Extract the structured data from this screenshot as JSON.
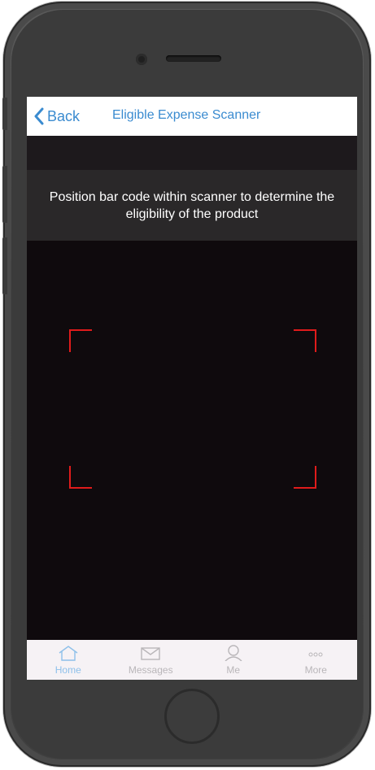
{
  "navbar": {
    "back_label": "Back",
    "title": "Eligible Expense Scanner"
  },
  "scanner": {
    "instruction": "Position bar code within scanner to determine the eligibility of the product",
    "frame_color": "#e01b1b"
  },
  "tabbar": {
    "active": "Home",
    "tabs": [
      {
        "label": "Home",
        "icon": "house-icon"
      },
      {
        "label": "Messages",
        "icon": "envelope-icon"
      },
      {
        "label": "Me",
        "icon": "person-icon"
      },
      {
        "label": "More",
        "icon": "ellipsis-icon"
      }
    ]
  },
  "colors": {
    "accent": "#3a8bd0",
    "active_tab": "#8ec0ea",
    "inactive_tab": "#b9b6b9"
  }
}
